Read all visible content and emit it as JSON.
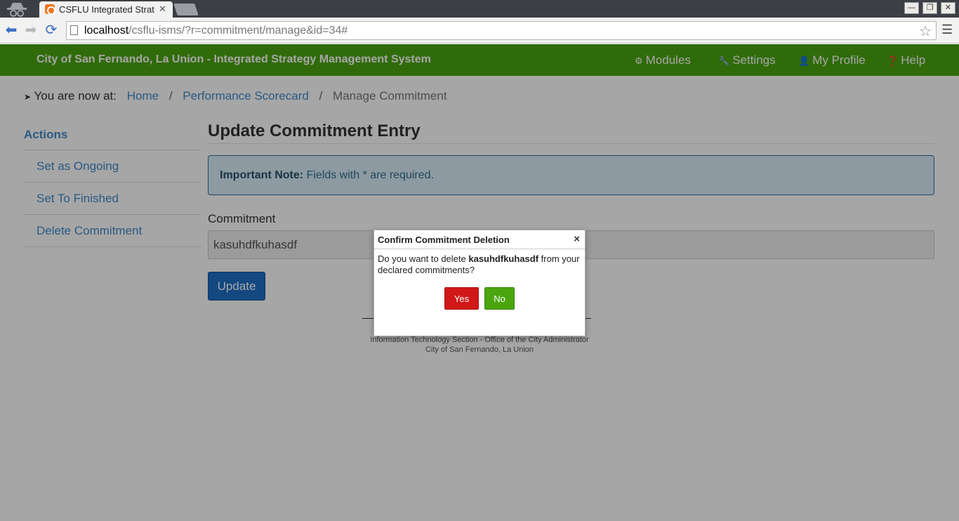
{
  "browser": {
    "tab_title": "CSFLU Integrated Strat",
    "url_host": "localhost",
    "url_path": "/csflu-isms/?r=commitment/manage&id=34#"
  },
  "navbar": {
    "brand": "City of San Fernando, La Union - Integrated Strategy Management System",
    "items": [
      {
        "label": "Modules",
        "icon": "gears-icon"
      },
      {
        "label": "Settings",
        "icon": "wrench-icon"
      },
      {
        "label": "My Profile",
        "icon": "user-icon"
      },
      {
        "label": "Help",
        "icon": "question-circle-icon"
      }
    ]
  },
  "breadcrumb": {
    "prefix": "You are now at:",
    "items": [
      "Home",
      "Performance Scorecard",
      "Manage Commitment"
    ],
    "separator": "/"
  },
  "sidebar": {
    "title": "Actions",
    "items": [
      "Set as Ongoing",
      "Set To Finished",
      "Delete Commitment"
    ]
  },
  "main": {
    "title": "Update Commitment Entry",
    "note_label": "Important Note:",
    "note_text": " Fields with * are required.",
    "field_label": "Commitment",
    "field_value": "kasuhdfkuhasdf",
    "update_label": "Update"
  },
  "footer": {
    "line1": "Information Technology Section - Office of the City Administrator",
    "line2": "City of San Fernando, La Union"
  },
  "dialog": {
    "title": "Confirm Commitment Deletion",
    "close": "×",
    "text_before": "Do you want to delete ",
    "item": "kasuhdfkuhasdf",
    "text_after": " from your declared commitments?",
    "yes_label": "Yes",
    "no_label": "No"
  },
  "colors": {
    "navbar": "#4aa50e",
    "link": "#428bca",
    "update_button": "#1e6fc7",
    "yes_button": "#d11818",
    "no_button": "#4aa50e"
  }
}
